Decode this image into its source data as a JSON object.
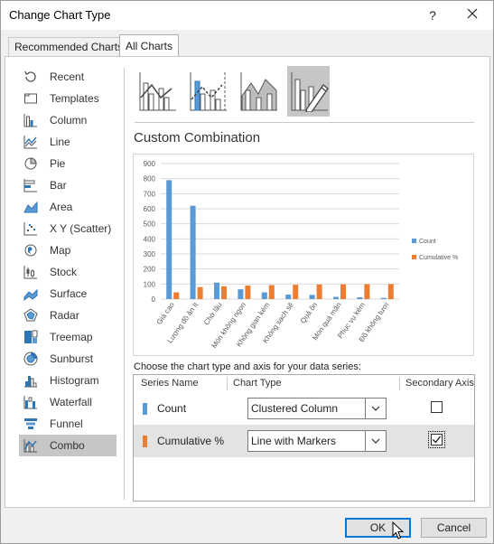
{
  "window": {
    "title": "Change Chart Type",
    "help_label": "?",
    "close_label": "✕"
  },
  "tabs": [
    {
      "label": "Recommended Charts",
      "active": false
    },
    {
      "label": "All Charts",
      "active": true
    }
  ],
  "sidebar": {
    "items": [
      {
        "label": "Recent",
        "icon": "recent-icon"
      },
      {
        "label": "Templates",
        "icon": "templates-icon"
      },
      {
        "label": "Column",
        "icon": "column-chart-icon"
      },
      {
        "label": "Line",
        "icon": "line-chart-icon"
      },
      {
        "label": "Pie",
        "icon": "pie-chart-icon"
      },
      {
        "label": "Bar",
        "icon": "bar-chart-icon"
      },
      {
        "label": "Area",
        "icon": "area-chart-icon"
      },
      {
        "label": "X Y (Scatter)",
        "icon": "scatter-chart-icon"
      },
      {
        "label": "Map",
        "icon": "map-chart-icon"
      },
      {
        "label": "Stock",
        "icon": "stock-chart-icon"
      },
      {
        "label": "Surface",
        "icon": "surface-chart-icon"
      },
      {
        "label": "Radar",
        "icon": "radar-chart-icon"
      },
      {
        "label": "Treemap",
        "icon": "treemap-chart-icon"
      },
      {
        "label": "Sunburst",
        "icon": "sunburst-chart-icon"
      },
      {
        "label": "Histogram",
        "icon": "histogram-chart-icon"
      },
      {
        "label": "Waterfall",
        "icon": "waterfall-chart-icon"
      },
      {
        "label": "Funnel",
        "icon": "funnel-chart-icon"
      },
      {
        "label": "Combo",
        "icon": "combo-chart-icon",
        "selected": true
      }
    ]
  },
  "combo": {
    "heading": "Custom Combination",
    "instructions": "Choose the chart type and axis for your data series:",
    "subtypes": [
      "clustered-column-line-icon",
      "clustered-column-line-secondary-icon",
      "stacked-area-clustered-column-icon",
      "custom-combination-icon"
    ]
  },
  "chart_data": {
    "type": "bar",
    "categories": [
      "Giá cao",
      "Lượng đồ ăn ít",
      "Chờ lâu",
      "Món không ngon",
      "Không gian kém",
      "Không sạch sẽ",
      "Quá ồn",
      "Món quá mặn",
      "Phục vụ kém",
      "Đồ không tươi"
    ],
    "series": [
      {
        "name": "Count",
        "values": [
          790,
          620,
          110,
          65,
          45,
          30,
          28,
          15,
          12,
          8
        ],
        "color": "#5b9bd5"
      },
      {
        "name": "Cumulative %",
        "values": [
          45,
          80,
          85,
          90,
          93,
          95,
          97,
          98,
          99,
          100
        ],
        "color": "#ed7d31"
      }
    ],
    "yticks": [
      "900",
      "800",
      "700",
      "600",
      "500",
      "400",
      "300",
      "200",
      "100",
      "0"
    ],
    "ylim": [
      0,
      900
    ]
  },
  "series_table": {
    "headers": {
      "name": "Series Name",
      "type": "Chart Type",
      "axis": "Secondary Axis"
    },
    "rows": [
      {
        "name": "Count",
        "color": "#5b9bd5",
        "type": "Clustered Column",
        "secondary": false
      },
      {
        "name": "Cumulative %",
        "color": "#ed7d31",
        "type": "Line with Markers",
        "secondary": true
      }
    ]
  },
  "buttons": {
    "ok": "OK",
    "cancel": "Cancel"
  }
}
